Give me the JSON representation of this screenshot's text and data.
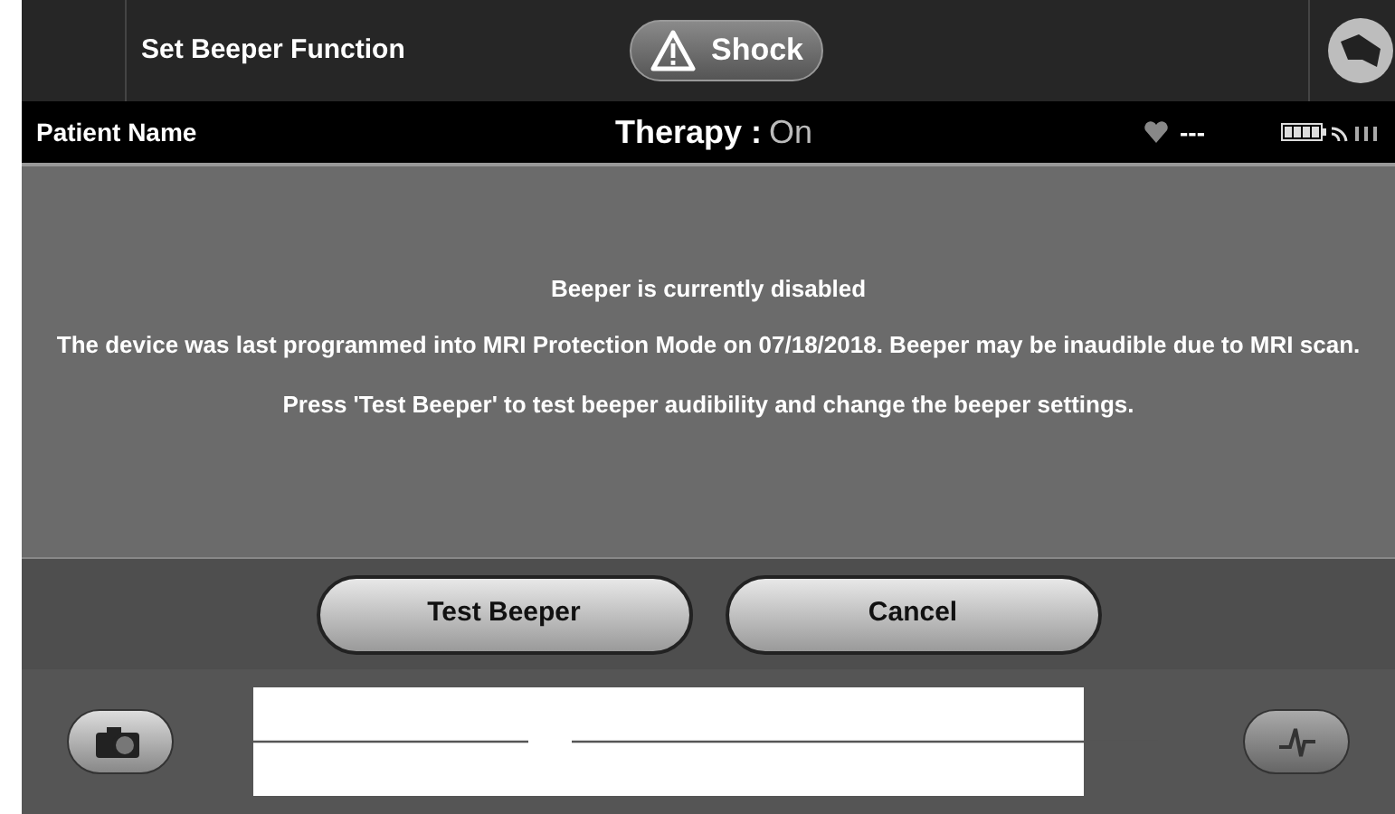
{
  "header": {
    "title": "Set Beeper Function",
    "shock_button": "Shock"
  },
  "status_bar": {
    "patient_name": "Patient Name",
    "therapy_label": "Therapy :",
    "therapy_value": "On",
    "heart_rate": "---"
  },
  "message": {
    "heading": "Beeper is currently disabled",
    "body": "The device was last programmed into MRI Protection Mode on 07/18/2018. Beeper may be inaudible due to MRI scan.",
    "instruction": "Press 'Test Beeper' to test beeper audibility and change the beeper settings."
  },
  "buttons": [
    "Test Beeper",
    "Cancel"
  ]
}
